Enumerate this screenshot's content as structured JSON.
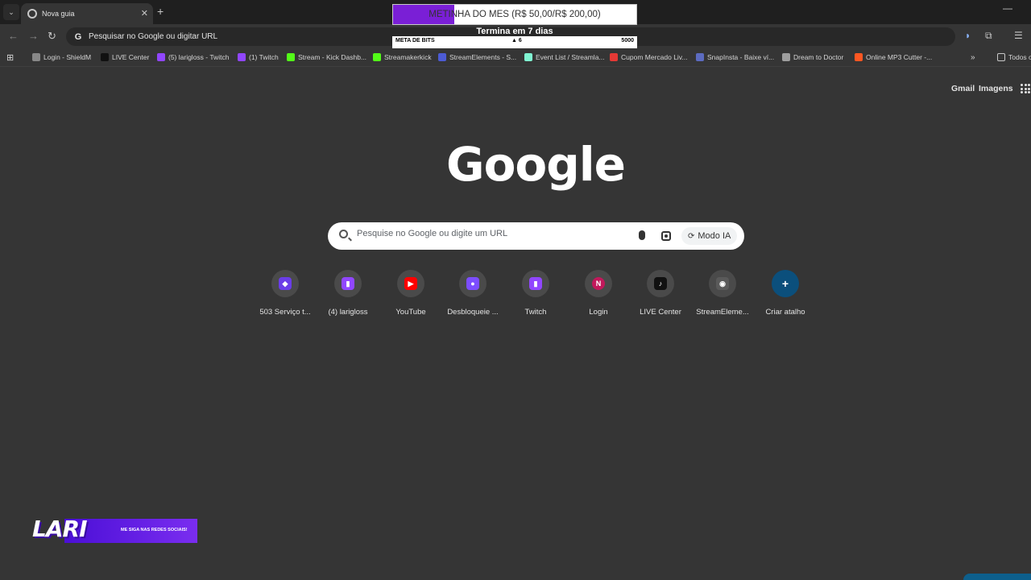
{
  "tab": {
    "title": "Nova guia",
    "close": "✕"
  },
  "new_tab": "+",
  "omnibox": {
    "text": "Pesquisar no Google ou digitar URL",
    "favicon": "G"
  },
  "bookmarks": [
    {
      "label": "Login - ShieldM",
      "color": "#888888"
    },
    {
      "label": "LIVE Center",
      "color": "#111111"
    },
    {
      "label": "(5) larigloss - Twitch",
      "color": "#9146ff"
    },
    {
      "label": "(1) Twitch",
      "color": "#9146ff"
    },
    {
      "label": "Stream - Kick Dashb...",
      "color": "#53fc18"
    },
    {
      "label": "Streamakerkick",
      "color": "#53fc18"
    },
    {
      "label": "StreamElements - S...",
      "color": "#4c5bd4"
    },
    {
      "label": "Event List / Streamla...",
      "color": "#80f5d2"
    },
    {
      "label": "Cupom Mercado Liv...",
      "color": "#e53935"
    },
    {
      "label": "SnapInsta - Baixe ví...",
      "color": "#5c6bc0"
    },
    {
      "label": "Dream to Doctor",
      "color": "#9e9e9e"
    },
    {
      "label": "Online MP3 Cutter -...",
      "color": "#ff5722"
    },
    {
      "label": "Todos o",
      "color": "#c7c7c7"
    }
  ],
  "overlay": {
    "goal_text": "METINHA DO MES (R$ 50,00/R$ 200,00)",
    "goal_progress": 0.25,
    "goal_sub": "Termina em 7 dias",
    "bits_label": "META DE BITS",
    "bits_current": "▲ 6",
    "bits_max": "5000"
  },
  "header": {
    "gmail": "Gmail",
    "images": "Imagens"
  },
  "logo": "Google",
  "search": {
    "placeholder": "Pesquise no Google ou digite um URL",
    "ai_mode": "Modo IA"
  },
  "shortcuts": [
    {
      "label": "503 Serviço t...",
      "color": "#6a3de8",
      "glyph": "◆"
    },
    {
      "label": "(4) larigloss",
      "color": "#9146ff",
      "glyph": "▮"
    },
    {
      "label": "YouTube",
      "color": "#ff0000",
      "glyph": "▶"
    },
    {
      "label": "Desbloqueie ...",
      "color": "#7c4dff",
      "glyph": "●"
    },
    {
      "label": "Twitch",
      "color": "#9146ff",
      "glyph": "▮"
    },
    {
      "label": "Login",
      "color": "#c2185b",
      "glyph": "N"
    },
    {
      "label": "LIVE Center",
      "color": "#111111",
      "glyph": "♪"
    },
    {
      "label": "StreamEleme...",
      "color": "#5a5a5a",
      "glyph": "◉"
    },
    {
      "label": "Criar atalho",
      "color": "#0b4f7c",
      "glyph": "+"
    }
  ],
  "lari": {
    "logo": "LARI",
    "subtitle": "ME SIGA NAS REDES SOCIAIS!"
  }
}
